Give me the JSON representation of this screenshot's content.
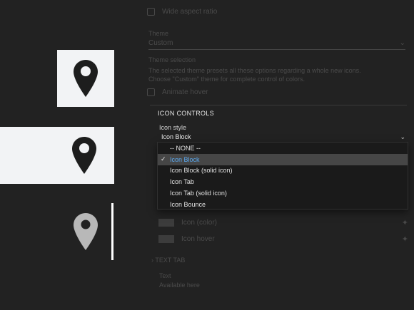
{
  "settings": {
    "wide_aspect_ratio_label": "Wide aspect ratio",
    "theme_label": "Theme",
    "theme_value": "Custom",
    "theme_selection_label": "Theme selection",
    "theme_note": "The selected theme presets all these options regarding a whole new icons. Choose \"Custom\" theme for complete control of colors.",
    "animate_hover_label": "Animate hover",
    "icon_normal_label": "Icon (color)",
    "icon_hover_label": "Icon hover",
    "text_tab_label": "TEXT TAB",
    "text_label": "Text",
    "text_value": "Available here"
  },
  "icon_controls": {
    "section_title": "ICON CONTROLS",
    "icon_style_label": "Icon style",
    "selected_value": "Icon Block",
    "options": [
      "-- NONE --",
      "Icon Block",
      "Icon Block (solid icon)",
      "Icon Tab",
      "Icon Tab (solid icon)",
      "Icon Bounce"
    ],
    "selected_index": 1
  },
  "icons": {
    "chevron": "chevron-down-icon",
    "check": "checkmark-icon",
    "marker": "location-pin-icon"
  },
  "colors": {
    "accent": "#5aa9f0",
    "background": "#222222",
    "preview_card": "#f2f3f5",
    "marker_dark": "#1d1d1d",
    "marker_light": "#b8b8b8"
  }
}
